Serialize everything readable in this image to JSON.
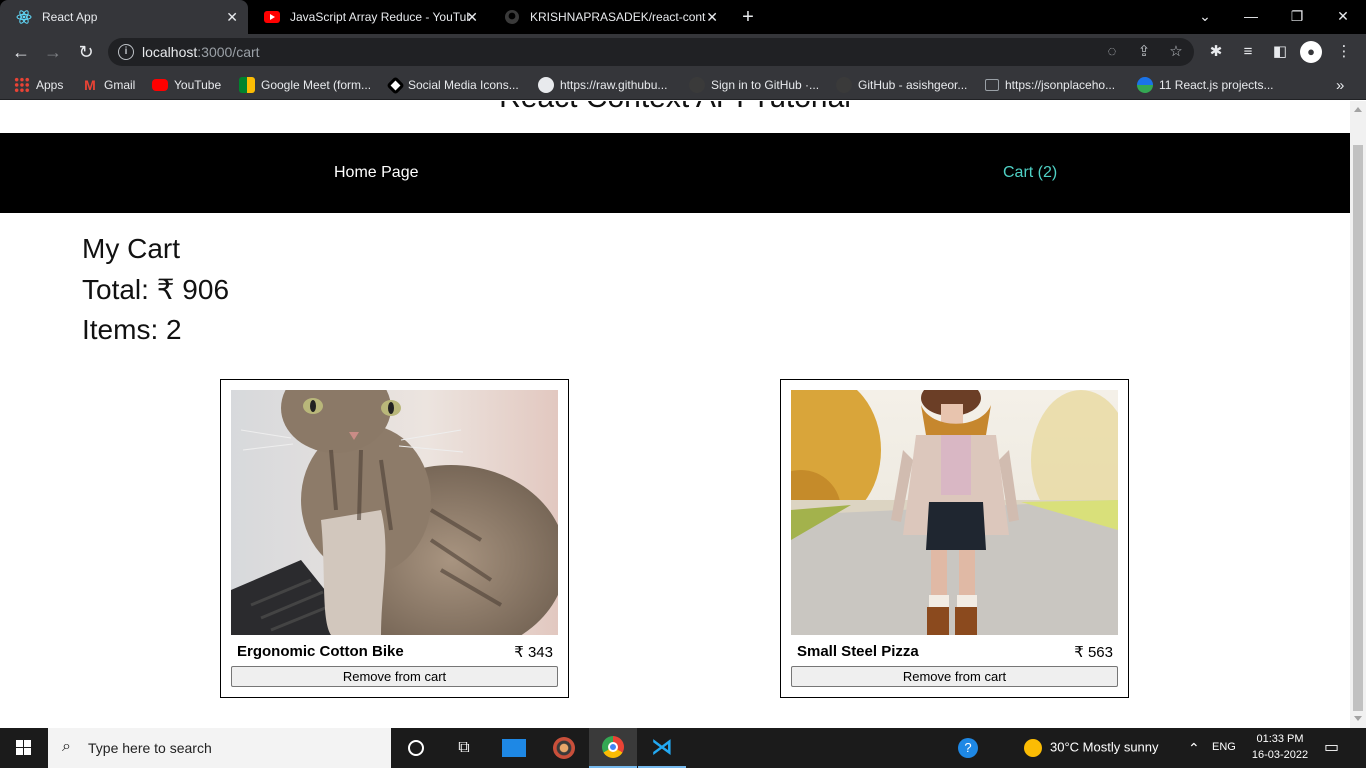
{
  "browser": {
    "tabs": [
      {
        "title": "React App",
        "active": true
      },
      {
        "title": "JavaScript Array Reduce - YouTube",
        "active": false
      },
      {
        "title": "KRISHNAPRASADEK/react-context",
        "active": false
      }
    ],
    "url_host": "localhost",
    "url_path": ":3000/cart",
    "bookmarks": [
      {
        "label": "Apps",
        "icon": "apps-grid-icon"
      },
      {
        "label": "Gmail",
        "icon": "gmail-icon"
      },
      {
        "label": "YouTube",
        "icon": "youtube-icon"
      },
      {
        "label": "Google Meet (form...",
        "icon": "google-meet-icon"
      },
      {
        "label": "Social Media Icons...",
        "icon": "social-media-icon"
      },
      {
        "label": "https://raw.githubu...",
        "icon": "github-raw-icon"
      },
      {
        "label": "Sign in to GitHub ·...",
        "icon": "github-icon"
      },
      {
        "label": "GitHub - asishgeor...",
        "icon": "github-icon"
      },
      {
        "label": "https://jsonplaceho...",
        "icon": "jsonplaceholder-icon"
      },
      {
        "label": "11 React.js projects...",
        "icon": "graduation-cap-icon"
      }
    ]
  },
  "page": {
    "site_title": "React Context API Tutorial",
    "nav": {
      "home": "Home Page",
      "cart": "Cart (2)"
    },
    "cart": {
      "heading": "My Cart",
      "total": "Total: ₹ 906",
      "items_count": "Items: 2"
    },
    "products": [
      {
        "name": "Ergonomic Cotton Bike",
        "price": "₹ 343",
        "button": "Remove from cart",
        "image": "cat-photo"
      },
      {
        "name": "Small Steel Pizza",
        "price": "₹ 563",
        "button": "Remove from cart",
        "image": "autumn-fashion-photo"
      }
    ]
  },
  "taskbar": {
    "search_placeholder": "Type here to search",
    "weather": "30°C  Mostly sunny",
    "language": "ENG",
    "time": "01:33 PM",
    "date": "16-03-2022"
  },
  "colors": {
    "cart_link": "#4fd1c5",
    "navbar_bg": "#000000",
    "chrome_dark": "#35363a"
  }
}
